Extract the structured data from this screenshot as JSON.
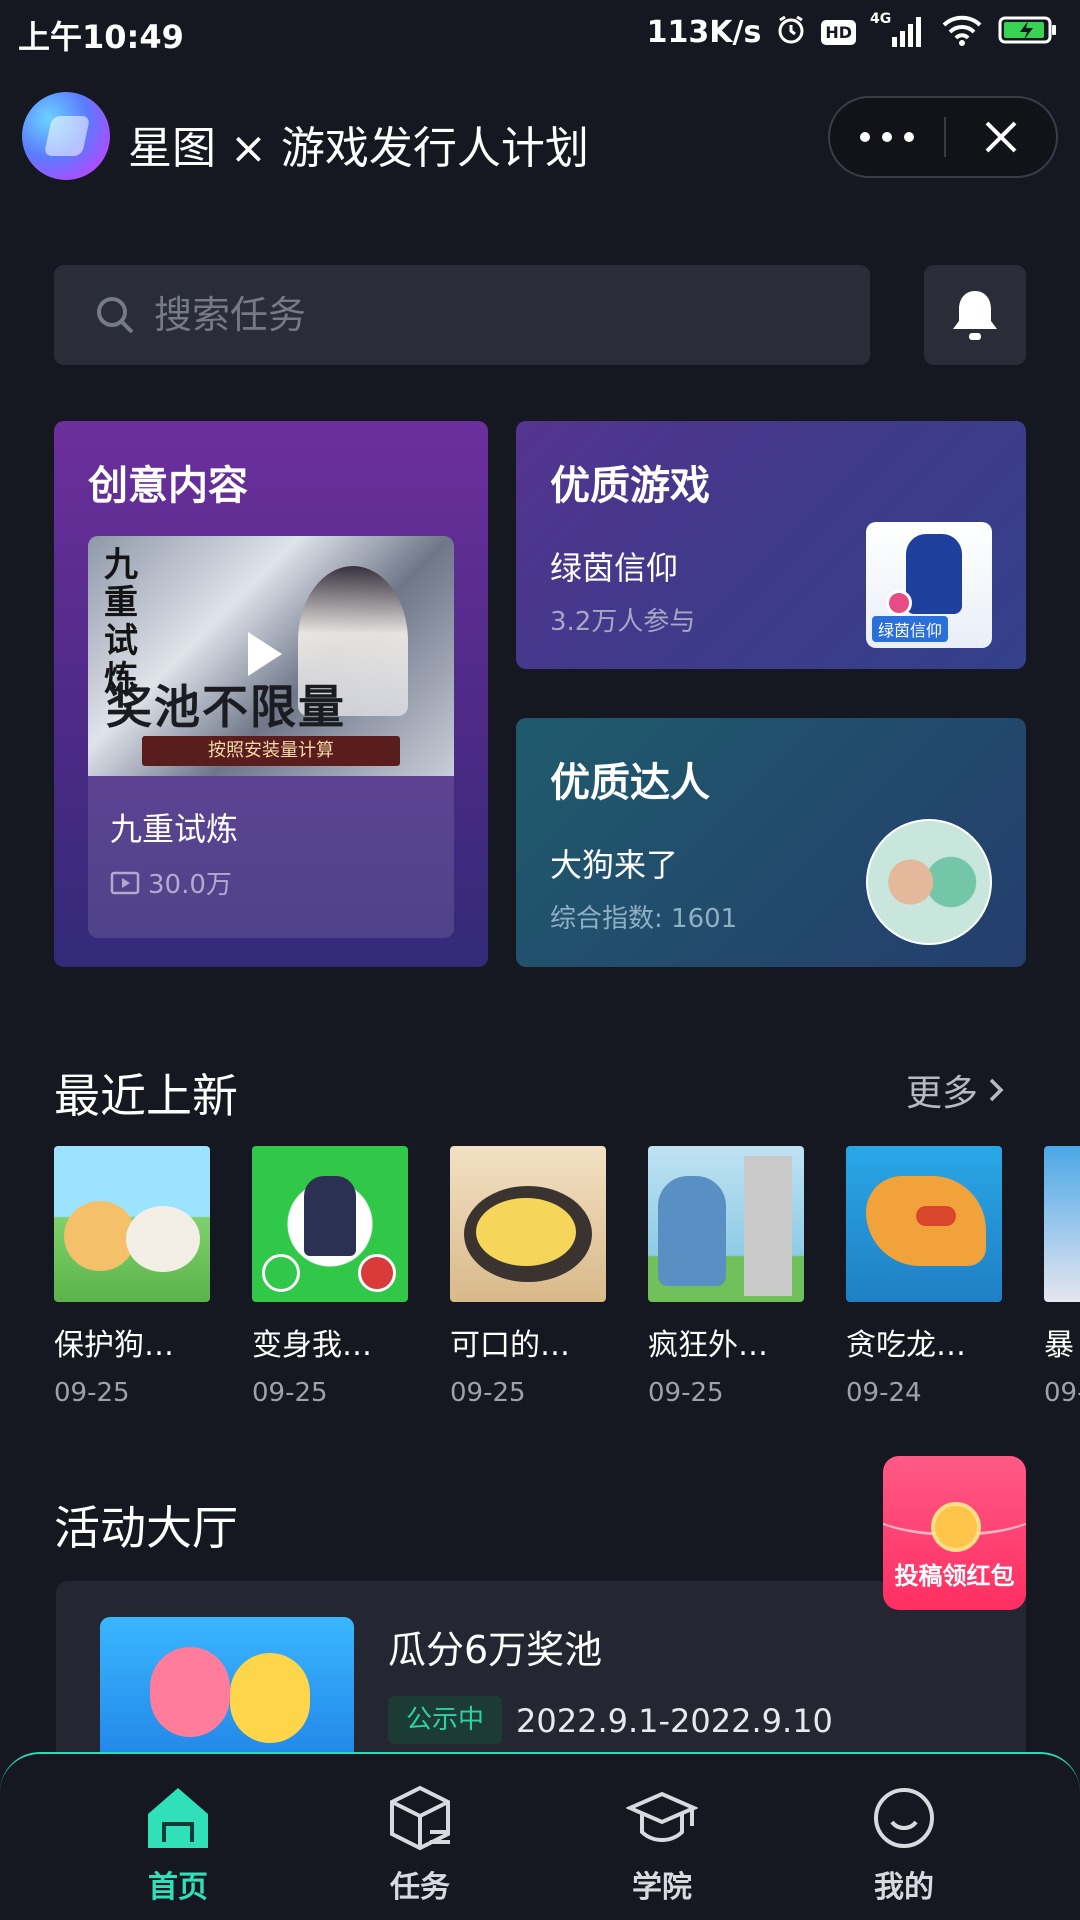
{
  "status_bar": {
    "time": "上午10:49",
    "net_speed": "113K/s",
    "hd": "HD",
    "network": "4G"
  },
  "header": {
    "title": "星图 × 游戏发行人计划",
    "more_icon": "more-dots-icon",
    "close_icon": "close-icon"
  },
  "search": {
    "placeholder": "搜索任务",
    "icon": "search-icon",
    "bell_icon": "bell-icon"
  },
  "cards": {
    "creative": {
      "title": "创意内容",
      "name": "九重试炼",
      "views": "30.0万",
      "thumb_vertical_text": "九重试炼",
      "thumb_slogan": "奖池不限量",
      "thumb_sub": "按照安装量计算"
    },
    "game": {
      "title": "优质游戏",
      "name": "绿茵信仰",
      "meta": "3.2万人参与",
      "thumb_label": "绿茵信仰"
    },
    "talent": {
      "title": "优质达人",
      "name": "大狗来了",
      "meta": "综合指数: 1601"
    }
  },
  "recent": {
    "title": "最近上新",
    "more": "更多",
    "games": [
      {
        "name": "保护狗…",
        "date": "09-25",
        "color1": "#7fd16b",
        "color2": "#f4c16a"
      },
      {
        "name": "变身我…",
        "date": "09-25",
        "color1": "#31c84a",
        "color2": "#d93a3a"
      },
      {
        "name": "可口的…",
        "date": "09-25",
        "color1": "#f2e1c4",
        "color2": "#a0522d"
      },
      {
        "name": "疯狂外…",
        "date": "09-25",
        "color1": "#8fcbe6",
        "color2": "#5a8fc4"
      },
      {
        "name": "贪吃龙…",
        "date": "09-24",
        "color1": "#2aa7e6",
        "color2": "#f2a23a"
      },
      {
        "name": "暴",
        "date": "09-",
        "color1": "#4aa7e6",
        "color2": "#e6e6f0"
      }
    ]
  },
  "activity": {
    "title": "活动大厅",
    "badge_text": "投稿领红包",
    "items": [
      {
        "name": "瓜分6万奖池",
        "status": "公示中",
        "dates": "2022.9.1-2022.9.10"
      }
    ]
  },
  "bottom_nav": [
    {
      "label": "首页",
      "icon": "home-icon",
      "active": true
    },
    {
      "label": "任务",
      "icon": "task-box-icon",
      "active": false
    },
    {
      "label": "学院",
      "icon": "graduation-cap-icon",
      "active": false
    },
    {
      "label": "我的",
      "icon": "profile-smile-icon",
      "active": false
    }
  ],
  "colors": {
    "background": "#151721",
    "accent": "#2fe0b9",
    "status_text": "#2dd1a6"
  }
}
